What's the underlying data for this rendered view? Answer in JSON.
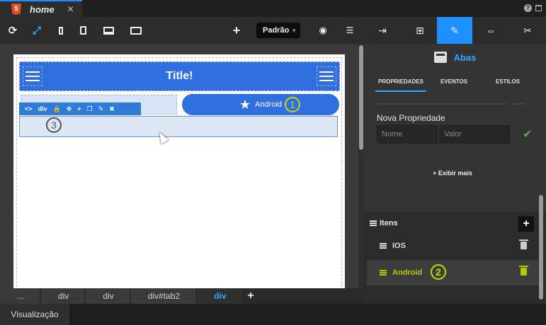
{
  "tabbar": {
    "file_tab": "home",
    "html5_badge": "5",
    "close": "✕",
    "help": "?"
  },
  "toolbar": {
    "refresh": "⟳",
    "fit": "⤢",
    "add": "+",
    "theme": "Padrão",
    "theme_caret": "▼",
    "eye": "◉",
    "db": "☰"
  },
  "canvas": {
    "app_title": "Title!",
    "tab_android_label": "Android",
    "star": "★",
    "mini_toolbar": {
      "code": "<>",
      "tag": "div",
      "lock": "🔒",
      "move": "✥",
      "add": "+",
      "copy": "❐",
      "magic": "✎",
      "remove": "✖"
    },
    "callout_1": "1",
    "callout_3": "3"
  },
  "breadcrumb": {
    "items": [
      "...",
      "div",
      "div",
      "div#tab2",
      "div"
    ],
    "add": "+"
  },
  "bottom": {
    "view_tab": "Visualização"
  },
  "panel": {
    "tabs": {
      "import": "⇥",
      "tree": "⊞",
      "edit": "✎",
      "resize": "⇔",
      "tools": "✂"
    },
    "component_title": "Abas",
    "subtabs": {
      "props": "PROPRIEDADES",
      "events": "EVENTOS",
      "styles": "ESTILOS"
    },
    "new_property": "Nova Propriedade",
    "name_placeholder": "Nome",
    "value_placeholder": "Valor",
    "check": "✔",
    "show_more": "+ Exibir mais",
    "items_header": "Itens",
    "add_item": "+",
    "items": [
      {
        "label": "IOS"
      },
      {
        "label": "Android"
      }
    ],
    "callout_2": "2"
  },
  "colors": {
    "accent": "#1e90ff",
    "brand_blue": "#2f6fe0",
    "highlight": "#b9c900",
    "callout": "#c8d800"
  }
}
